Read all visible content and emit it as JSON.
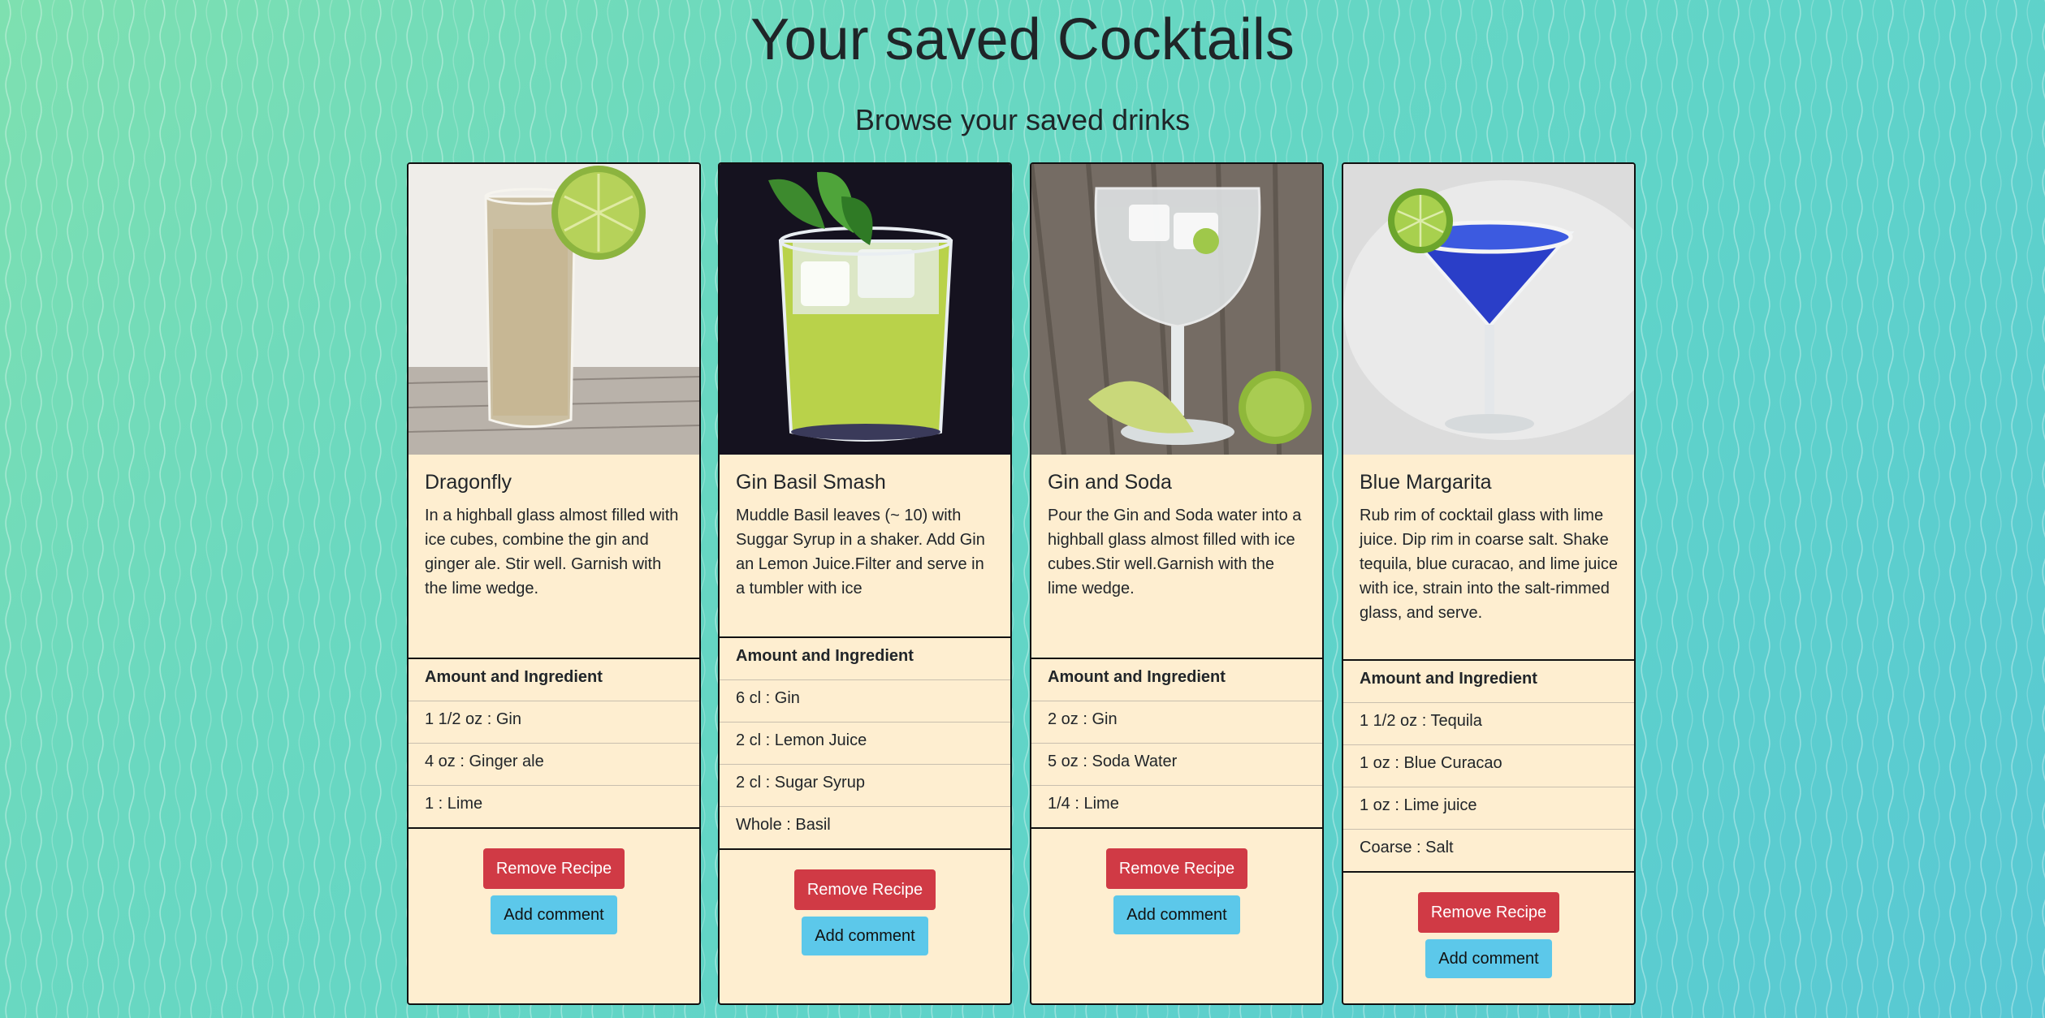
{
  "header": {
    "title": "Your saved Cocktails",
    "subtitle": "Browse your saved drinks"
  },
  "cards": [
    {
      "name": "Dragonfly",
      "instructions": "In a highball glass almost filled with ice cubes, combine the gin and ginger ale. Stir well. Garnish with the lime wedge.",
      "ingredients_header": "Amount and Ingredient",
      "ingredients": [
        "1 1/2 oz : Gin",
        "4 oz : Ginger ale",
        "1 : Lime"
      ],
      "remove_label": "Remove Recipe",
      "comment_label": "Add comment"
    },
    {
      "name": "Gin Basil Smash",
      "instructions": "Muddle Basil leaves (~ 10) with Suggar Syrup in a shaker. Add Gin an Lemon Juice.Filter and serve in a tumbler with ice",
      "ingredients_header": "Amount and Ingredient",
      "ingredients": [
        "6 cl : Gin",
        "2 cl : Lemon Juice",
        "2 cl : Sugar Syrup",
        "Whole : Basil"
      ],
      "remove_label": "Remove Recipe",
      "comment_label": "Add comment"
    },
    {
      "name": "Gin and Soda",
      "instructions": "Pour the Gin and Soda water into a highball glass almost filled with ice cubes.Stir well.Garnish with the lime wedge.",
      "ingredients_header": "Amount and Ingredient",
      "ingredients": [
        "2 oz : Gin",
        "5 oz : Soda Water",
        "1/4 : Lime"
      ],
      "remove_label": "Remove Recipe",
      "comment_label": "Add comment"
    },
    {
      "name": "Blue Margarita",
      "instructions": "Rub rim of cocktail glass with lime juice. Dip rim in coarse salt. Shake tequila, blue curacao, and lime juice with ice, strain into the salt-rimmed glass, and serve.",
      "ingredients_header": "Amount and Ingredient",
      "ingredients": [
        "1 1/2 oz : Tequila",
        "1 oz : Blue Curacao",
        "1 oz : Lime juice",
        "Coarse : Salt"
      ],
      "remove_label": "Remove Recipe",
      "comment_label": "Add comment"
    }
  ],
  "colors": {
    "card_background": "#feeed0",
    "remove_button": "#d03a45",
    "comment_button": "#5cc8ea"
  }
}
